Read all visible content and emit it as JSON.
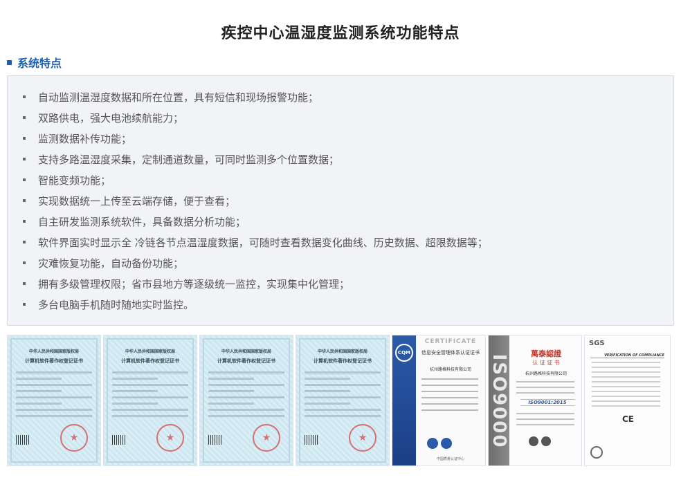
{
  "page": {
    "title": "疾控中心温湿度监测系统功能特点"
  },
  "section": {
    "label": "系统特点"
  },
  "features": [
    "自动监测温湿度数据和所在位置，具有短信和现场报警功能；",
    "双路供电，强大电池续航能力；",
    "监测数据补传功能；",
    "支持多路温湿度采集，定制通道数量，可同时监测多个位置数据；",
    "智能变频功能；",
    "实现数据统一上传至云端存储，便于查看；",
    "自主研发监测系统软件，具备数据分析功能；",
    "软件界面实时显示全 冷链各节点温湿度数据，可随时查看数据变化曲线、历史数据、超限数据等；",
    "灾难恢复功能，自动备份功能；",
    "拥有多级管理权限；省市县地方等逐级统一监控，实现集中化管理；",
    "多台电脑手机随时随地实时监控。"
  ],
  "certificates": {
    "copyright_line1": "中华人民共和国国家版权局",
    "copyright_line2": "计算机软件著作权登记证书",
    "cqm_logo": "CQM",
    "cqm_title": "CERTIFICATE",
    "cqm_subtitle": "信息安全管理体系认证证书",
    "cqm_company": "杭州路格科技有限公司",
    "cqm_footer": "中国质量认证中心",
    "iso_band": "ISO9000",
    "iso_brand": "萬泰認證",
    "iso_subtitle": "认 证 证 书",
    "iso_company": "杭州路格科技有限公司",
    "iso_standard": "ISO9001:2015",
    "sgs_logo": "SGS",
    "sgs_heading": "VERIFICATION OF COMPLIANCE",
    "sgs_ce": "CE"
  }
}
